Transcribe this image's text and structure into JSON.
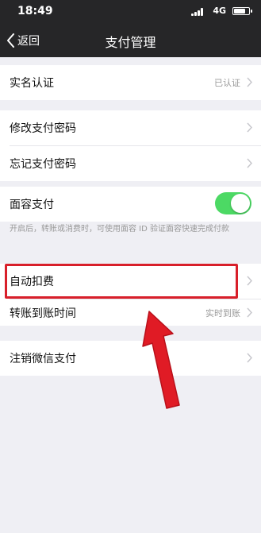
{
  "status_bar": {
    "time": "18:49",
    "network": "4G"
  },
  "nav": {
    "back_label": "返回",
    "title": "支付管理"
  },
  "groups": {
    "identity": {
      "label": "实名认证",
      "value": "已认证"
    },
    "password": [
      {
        "label": "修改支付密码"
      },
      {
        "label": "忘记支付密码"
      }
    ],
    "face": {
      "label": "面容支付",
      "enabled": true,
      "note": "开启后，转账或消费时，可使用面容 ID 验证面容快速完成付款"
    },
    "deduction": [
      {
        "label": "自动扣费"
      },
      {
        "label": "转账到账时间",
        "value": "实时到账"
      }
    ],
    "cancel": {
      "label": "注销微信支付"
    }
  },
  "colors": {
    "nav_bg": "#262628",
    "page_bg": "#efeff4",
    "toggle_on": "#4cd964",
    "annotation_red": "#d81f2a"
  }
}
